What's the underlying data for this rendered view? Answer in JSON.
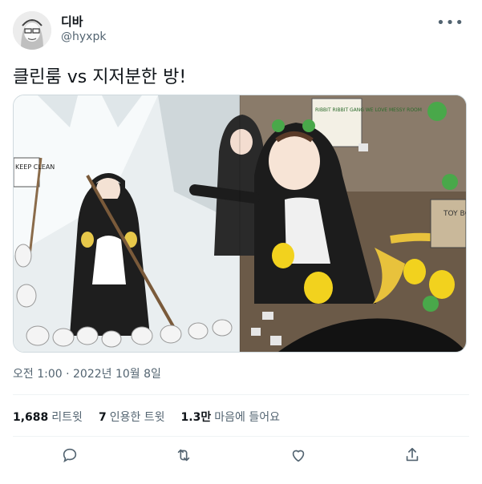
{
  "author": {
    "display_name": "디바",
    "handle": "@hyxpk"
  },
  "tweet": {
    "text": "클린룸 vs 지저분한 방!",
    "timestamp": "오전 1:00 · 2022년 10월 8일"
  },
  "image": {
    "left_sign": "KEEP CLEAN",
    "right_sign": "RIBBIT RIBBIT GANG WE LOVE MESSY ROOM",
    "box_label": "TOY BO"
  },
  "stats": {
    "retweets_count": "1,688",
    "retweets_label": "리트윗",
    "quotes_count": "7",
    "quotes_label": "인용한 트윗",
    "likes_count": "1.3만",
    "likes_label": "마음에 들어요"
  },
  "icons": {
    "more": "more-icon",
    "reply": "reply-icon",
    "retweet": "retweet-icon",
    "like": "like-icon",
    "share": "share-icon"
  }
}
